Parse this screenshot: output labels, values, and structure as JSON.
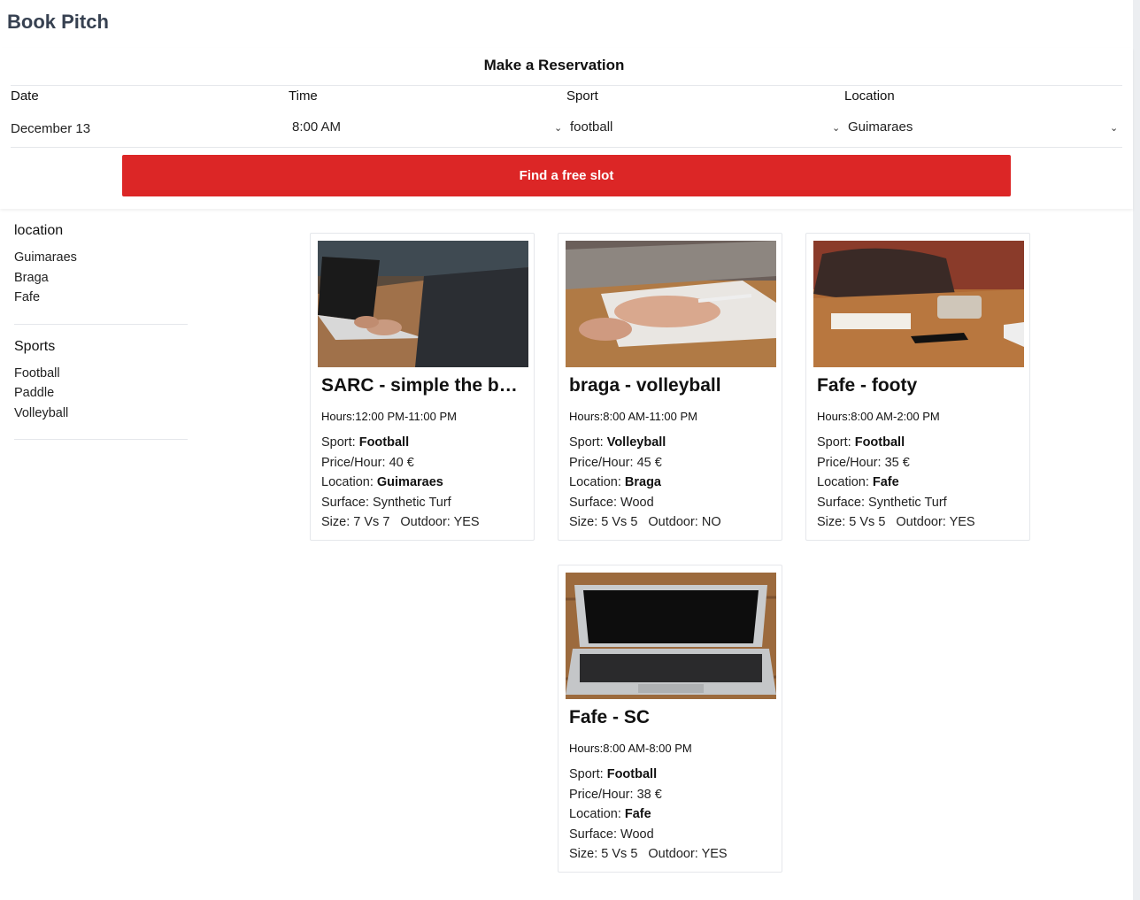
{
  "brand": "Book Pitch",
  "reservation": {
    "title": "Make a Reservation",
    "date_label": "Date",
    "date_value": "December 13",
    "time_label": "Time",
    "time_value": "8:00 AM",
    "sport_label": "Sport",
    "sport_value": "football",
    "location_label": "Location",
    "location_value": "Guimaraes",
    "find_button": "Find a free slot"
  },
  "filters": {
    "location_heading": "location",
    "locations": [
      "Guimaraes",
      "Braga",
      "Fafe"
    ],
    "sports_heading": "Sports",
    "sports": [
      "Football",
      "Paddle",
      "Volleyball"
    ]
  },
  "labels": {
    "hours": "Hours:",
    "sport": "Sport:",
    "price": "Price/Hour:",
    "location": "Location:",
    "surface": "Surface:",
    "size": "Size:",
    "outdoor": "Outdoor:"
  },
  "pitches": [
    {
      "name": "SARC - simple the best",
      "hours": "12:00 PM-11:00 PM",
      "sport": "Football",
      "price": "40 €",
      "location": "Guimaraes",
      "surface": "Synthetic Turf",
      "size": "7 Vs 7",
      "outdoor": "YES"
    },
    {
      "name": "braga - volleyball",
      "hours": "8:00 AM-11:00 PM",
      "sport": "Volleyball",
      "price": "45 €",
      "location": "Braga",
      "surface": "Wood",
      "size": "5 Vs 5",
      "outdoor": "NO"
    },
    {
      "name": "Fafe - footy",
      "hours": "8:00 AM-2:00 PM",
      "sport": "Football",
      "price": "35 €",
      "location": "Fafe",
      "surface": "Synthetic Turf",
      "size": "5 Vs 5",
      "outdoor": "YES"
    },
    {
      "name": "Fafe - SC",
      "hours": "8:00 AM-8:00 PM",
      "sport": "Football",
      "price": "38 €",
      "location": "Fafe",
      "surface": "Wood",
      "size": "5 Vs 5",
      "outdoor": "YES"
    }
  ],
  "colors": {
    "accent": "#dc2626",
    "brand_text": "#374151"
  }
}
